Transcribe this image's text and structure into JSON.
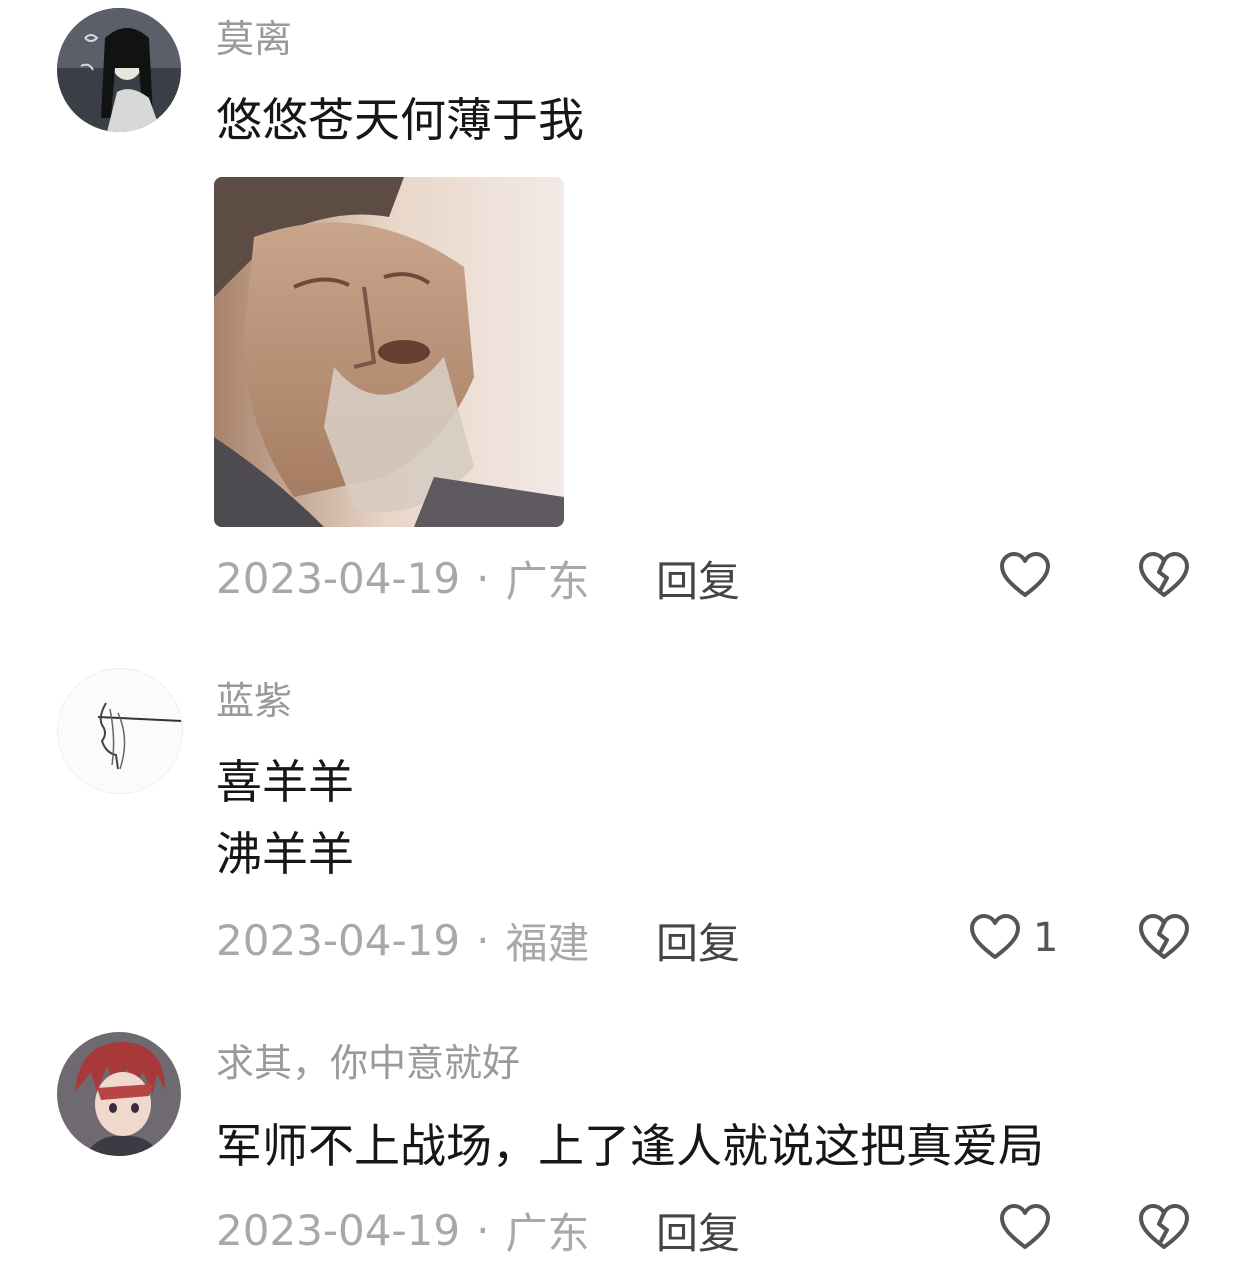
{
  "comments": [
    {
      "username": "莫离",
      "text_lines": [
        "悠悠苍天何薄于我"
      ],
      "date": "2023-04-19",
      "separator": "·",
      "location": "广东",
      "reply_label": "回复",
      "like_count": "",
      "avatar_icon": "ink-style-character-avatar",
      "has_image": true,
      "image_icon": "elderly-man-sighing-meme"
    },
    {
      "username": "蓝紫",
      "text_lines": [
        "喜羊羊",
        "沸羊羊"
      ],
      "date": "2023-04-19",
      "separator": "·",
      "location": "福建",
      "reply_label": "回复",
      "like_count": "1",
      "avatar_icon": "line-art-profile-avatar",
      "has_image": false
    },
    {
      "username": "求其，你中意就好",
      "text_lines": [
        "军师不上战场，上了逢人就说这把真爱局"
      ],
      "date": "2023-04-19",
      "separator": "·",
      "location": "广东",
      "reply_label": "回复",
      "like_count": "",
      "avatar_icon": "anime-red-hair-avatar",
      "has_image": false
    }
  ],
  "icons": {
    "like": "heart-outline-icon",
    "dislike": "broken-heart-outline-icon"
  },
  "colors": {
    "username": "#9a9a9a",
    "content": "#161616",
    "meta": "#a8a8a8",
    "reply": "#444444",
    "icon": "#555555"
  }
}
